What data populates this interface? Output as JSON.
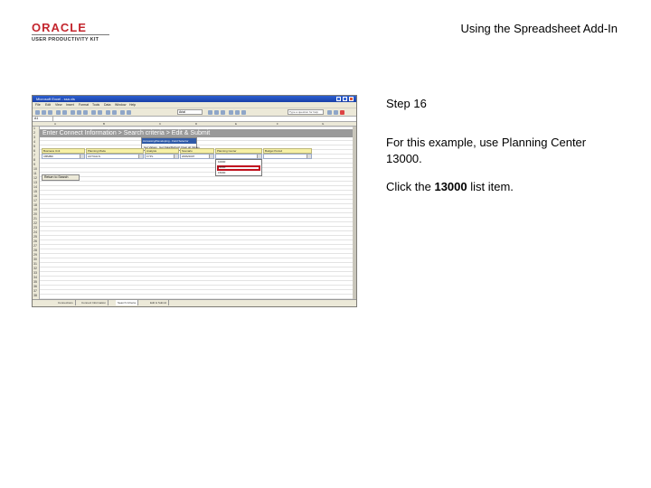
{
  "branding": {
    "oracle": "ORACLE",
    "upk": "USER PRODUCTIVITY KIT"
  },
  "page_title": "Using the Spreadsheet Add-In",
  "instructions": {
    "step": "Step 16",
    "line1": "For this example, use Planning Center 13000.",
    "click_prefix": "Click the ",
    "click_target": "13000",
    "click_suffix": " list item."
  },
  "screenshot": {
    "window_title": "Microsoft Excel - ssa.xls",
    "menus": [
      "File",
      "Edit",
      "View",
      "Insert",
      "Format",
      "Tools",
      "Data",
      "Window",
      "Help"
    ],
    "font_name": "Arial",
    "help_placeholder": "Type a question for help",
    "name_box": "A1",
    "column_letters": [
      "A",
      "B",
      "C",
      "D",
      "E",
      "F",
      "G"
    ],
    "breadcrumb": "Enter Connect Information > Search criteria > Edit & Submit",
    "popup": {
      "title": "Accessing/Developing - Field Selector",
      "buttons": [
        "Get Values",
        "Get Data/Refresh",
        "Clear all Values"
      ]
    },
    "field_headers": [
      "Business Unit",
      "Planning Mode",
      "Analysis",
      "Scenario",
      "Planning Center",
      "Budget Period"
    ],
    "field_values": [
      "CBMBD",
      "ACTUALS",
      "FYPL",
      "2006/2007",
      "",
      ""
    ],
    "dropdown_items": [
      "10000",
      "13000",
      "15000"
    ],
    "return_button": "Return to Search",
    "row_numbers": [
      "1",
      "2",
      "3",
      "4",
      "5",
      "6",
      "7",
      "8",
      "9",
      "10",
      "11",
      "12",
      "13",
      "14",
      "15",
      "16",
      "17",
      "18",
      "19",
      "20",
      "21",
      "22",
      "23",
      "24",
      "25",
      "26",
      "27",
      "28",
      "29",
      "30",
      "31",
      "32",
      "33",
      "34",
      "35",
      "36",
      "37",
      "38"
    ],
    "sheet_tabs": [
      "Connections",
      "Connect Information",
      "Search Criteria",
      "Edit & Submit"
    ],
    "active_tab": "Search Criteria"
  }
}
